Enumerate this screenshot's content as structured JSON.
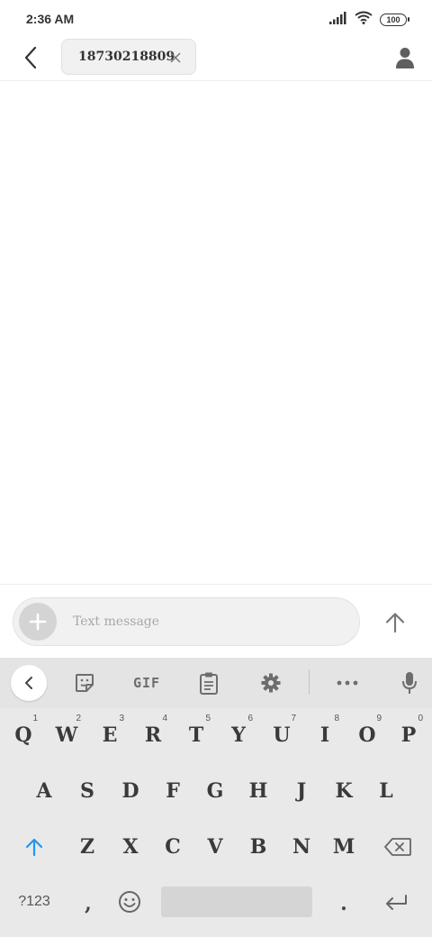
{
  "status_bar": {
    "time": "2:36 AM",
    "battery": "100"
  },
  "header": {
    "recipient": "18730218809"
  },
  "compose": {
    "placeholder": "Text message"
  },
  "keyboard": {
    "toolbar": {
      "gif_label": "GIF"
    },
    "row1": [
      {
        "key": "Q",
        "hint": "1"
      },
      {
        "key": "W",
        "hint": "2"
      },
      {
        "key": "E",
        "hint": "3"
      },
      {
        "key": "R",
        "hint": "4"
      },
      {
        "key": "T",
        "hint": "5"
      },
      {
        "key": "Y",
        "hint": "6"
      },
      {
        "key": "U",
        "hint": "7"
      },
      {
        "key": "I",
        "hint": "8"
      },
      {
        "key": "O",
        "hint": "9"
      },
      {
        "key": "P",
        "hint": "0"
      }
    ],
    "row2": [
      "A",
      "S",
      "D",
      "F",
      "G",
      "H",
      "J",
      "K",
      "L"
    ],
    "row3": [
      "Z",
      "X",
      "C",
      "V",
      "B",
      "N",
      "M"
    ],
    "bottom": {
      "symbols_label": "?123",
      "comma": ",",
      "period": "."
    }
  },
  "colors": {
    "accent": "#2196f3",
    "keyboard_bg": "#e9e9e9",
    "chip_bg": "#f1f1f1"
  }
}
